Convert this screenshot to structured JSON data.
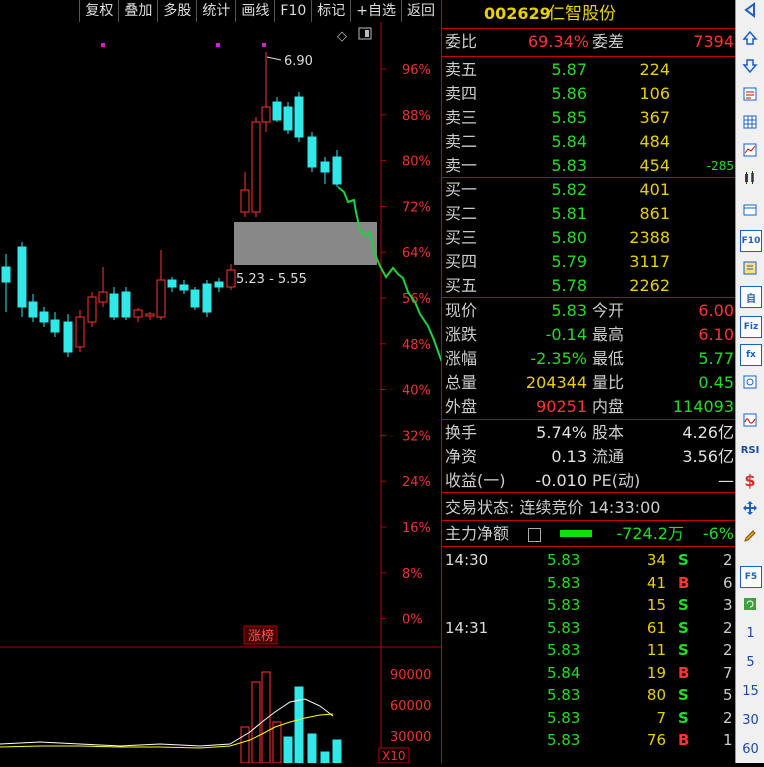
{
  "toolbar": [
    "复权",
    "叠加",
    "多股",
    "统计",
    "画线",
    "F10",
    "标记",
    "+自选",
    "返回"
  ],
  "stock": {
    "code": "002629",
    "name": "仁智股份"
  },
  "commission": {
    "ratio_label": "委比",
    "ratio": "69.34%",
    "diff_label": "委差",
    "diff": "7394"
  },
  "asks": [
    {
      "label": "卖五",
      "price": "5.87",
      "vol": "224",
      "extra": ""
    },
    {
      "label": "卖四",
      "price": "5.86",
      "vol": "106",
      "extra": ""
    },
    {
      "label": "卖三",
      "price": "5.85",
      "vol": "367",
      "extra": ""
    },
    {
      "label": "卖二",
      "price": "5.84",
      "vol": "484",
      "extra": ""
    },
    {
      "label": "卖一",
      "price": "5.83",
      "vol": "454",
      "extra": "-285"
    }
  ],
  "bids": [
    {
      "label": "买一",
      "price": "5.82",
      "vol": "401"
    },
    {
      "label": "买二",
      "price": "5.81",
      "vol": "861"
    },
    {
      "label": "买三",
      "price": "5.80",
      "vol": "2388"
    },
    {
      "label": "买四",
      "price": "5.79",
      "vol": "3117"
    },
    {
      "label": "买五",
      "price": "5.78",
      "vol": "2262"
    }
  ],
  "quote": [
    {
      "l1": "现价",
      "v1": "5.83",
      "c1": "grn",
      "l2": "今开",
      "v2": "6.00",
      "c2": "red"
    },
    {
      "l1": "涨跌",
      "v1": "-0.14",
      "c1": "grn",
      "l2": "最高",
      "v2": "6.10",
      "c2": "red"
    },
    {
      "l1": "涨幅",
      "v1": "-2.35%",
      "c1": "grn",
      "l2": "最低",
      "v2": "5.77",
      "c2": "grn"
    },
    {
      "l1": "总量",
      "v1": "204344",
      "c1": "yel",
      "l2": "量比",
      "v2": "0.45",
      "c2": "grn"
    },
    {
      "l1": "外盘",
      "v1": "90251",
      "c1": "red",
      "l2": "内盘",
      "v2": "114093",
      "c2": "grn"
    }
  ],
  "finance": [
    {
      "l1": "换手",
      "v1": "5.74%",
      "l2": "股本",
      "v2": "4.26亿"
    },
    {
      "l1": "净资",
      "v1": "0.13",
      "l2": "流通",
      "v2": "3.56亿"
    },
    {
      "l1": "收益(一)",
      "v1": "-0.010",
      "l2": "PE(动)",
      "v2": "—"
    }
  ],
  "trade_status": "交易状态: 连续竞价 14:33:00",
  "main_flow": {
    "label": "主力净额",
    "value": "-724.2万",
    "pct": "-6%"
  },
  "ticks": [
    {
      "time": "14:30",
      "price": "5.83",
      "pc": "grn",
      "vol": "34",
      "bs": "S",
      "n": "2"
    },
    {
      "time": "",
      "price": "5.83",
      "pc": "grn",
      "vol": "41",
      "bs": "B",
      "n": "6"
    },
    {
      "time": "",
      "price": "5.83",
      "pc": "grn",
      "vol": "15",
      "bs": "S",
      "n": "3"
    },
    {
      "time": "14:31",
      "price": "5.83",
      "pc": "grn",
      "vol": "61",
      "bs": "S",
      "n": "2"
    },
    {
      "time": "",
      "price": "5.83",
      "pc": "grn",
      "vol": "11",
      "bs": "S",
      "n": "2"
    },
    {
      "time": "",
      "price": "5.84",
      "pc": "grn",
      "vol": "19",
      "bs": "B",
      "n": "7"
    },
    {
      "time": "",
      "price": "5.83",
      "pc": "grn",
      "vol": "80",
      "bs": "S",
      "n": "5"
    },
    {
      "time": "",
      "price": "5.83",
      "pc": "grn",
      "vol": "7",
      "bs": "S",
      "n": "2"
    },
    {
      "time": "",
      "price": "5.83",
      "pc": "grn",
      "vol": "76",
      "bs": "B",
      "n": "1"
    }
  ],
  "chart": {
    "pct_labels": [
      "96%",
      "88%",
      "80%",
      "72%",
      "64%",
      "56%",
      "48%",
      "40%",
      "32%",
      "24%",
      "16%",
      "8%",
      "0%"
    ],
    "high_annotation": "6.90",
    "zone_annotation": "5.23 - 5.55",
    "indicator_label": "涨榜",
    "vol_labels": [
      "90000",
      "60000",
      "30000"
    ],
    "vol_unit": "X10"
  },
  "side_numbers": [
    "1",
    "5",
    "15",
    "30",
    "60"
  ],
  "colors": {
    "up": "#ff3333",
    "down": "#30e8e8",
    "accent_red": "#c00000"
  }
}
